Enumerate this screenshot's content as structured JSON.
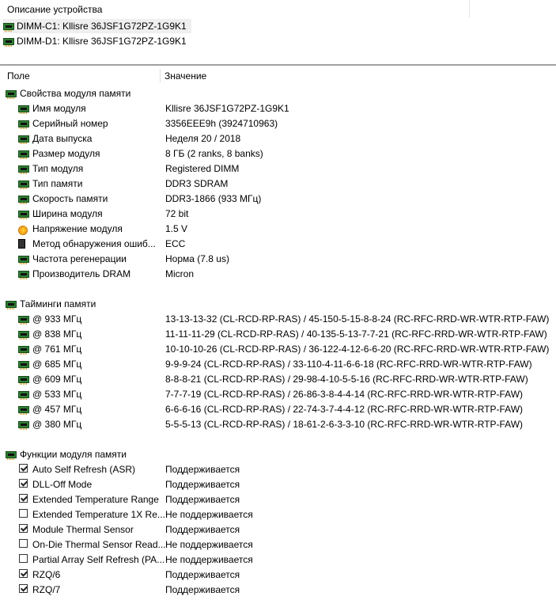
{
  "device_panel": {
    "title": "Описание устройства",
    "devices": [
      {
        "label": "DIMM-C1: Kllisre 36JSF1G72PZ-1G9K1",
        "selected": true
      },
      {
        "label": "DIMM-D1: Kllisre 36JSF1G72PZ-1G9K1",
        "selected": false
      }
    ]
  },
  "columns": {
    "field": "Поле",
    "value": "Значение"
  },
  "groups": {
    "props": {
      "label": "Свойства модуля памяти",
      "rows": [
        {
          "name": "Имя модуля",
          "value": "Kllisre 36JSF1G72PZ-1G9K1",
          "icon": "ram-icon"
        },
        {
          "name": "Серийный номер",
          "value": "3356EEE9h (3924710963)",
          "icon": "ram-icon"
        },
        {
          "name": "Дата выпуска",
          "value": "Неделя 20 / 2018",
          "icon": "ram-icon"
        },
        {
          "name": "Размер модуля",
          "value": "8 ГБ (2 ranks, 8 banks)",
          "icon": "ram-icon"
        },
        {
          "name": "Тип модуля",
          "value": "Registered DIMM",
          "icon": "ram-icon"
        },
        {
          "name": "Тип памяти",
          "value": "DDR3 SDRAM",
          "icon": "ram-icon"
        },
        {
          "name": "Скорость памяти",
          "value": "DDR3-1866 (933 МГц)",
          "icon": "ram-icon"
        },
        {
          "name": "Ширина модуля",
          "value": "72 bit",
          "icon": "ram-icon"
        },
        {
          "name": "Напряжение модуля",
          "value": "1.5 V",
          "icon": "voltage-icon"
        },
        {
          "name": "Метод обнаружения ошиб...",
          "value": "ECC",
          "icon": "chip-icon"
        },
        {
          "name": "Частота регенерации",
          "value": "Норма (7.8 us)",
          "icon": "ram-icon"
        },
        {
          "name": "Производитель DRAM",
          "value": "Micron",
          "icon": "ram-icon"
        }
      ]
    },
    "timings": {
      "label": "Тайминги памяти",
      "rows": [
        {
          "name": "@ 933 МГц",
          "value": "13-13-13-32  (CL-RCD-RP-RAS) / 45-150-5-15-8-8-24  (RC-RFC-RRD-WR-WTR-RTP-FAW)"
        },
        {
          "name": "@ 838 МГц",
          "value": "11-11-11-29  (CL-RCD-RP-RAS) / 40-135-5-13-7-7-21  (RC-RFC-RRD-WR-WTR-RTP-FAW)"
        },
        {
          "name": "@ 761 МГц",
          "value": "10-10-10-26  (CL-RCD-RP-RAS) / 36-122-4-12-6-6-20  (RC-RFC-RRD-WR-WTR-RTP-FAW)"
        },
        {
          "name": "@ 685 МГц",
          "value": "9-9-9-24  (CL-RCD-RP-RAS) / 33-110-4-11-6-6-18  (RC-RFC-RRD-WR-WTR-RTP-FAW)"
        },
        {
          "name": "@ 609 МГц",
          "value": "8-8-8-21  (CL-RCD-RP-RAS) / 29-98-4-10-5-5-16  (RC-RFC-RRD-WR-WTR-RTP-FAW)"
        },
        {
          "name": "@ 533 МГц",
          "value": "7-7-7-19  (CL-RCD-RP-RAS) / 26-86-3-8-4-4-14  (RC-RFC-RRD-WR-WTR-RTP-FAW)"
        },
        {
          "name": "@ 457 МГц",
          "value": "6-6-6-16  (CL-RCD-RP-RAS) / 22-74-3-7-4-4-12  (RC-RFC-RRD-WR-WTR-RTP-FAW)"
        },
        {
          "name": "@ 380 МГц",
          "value": "5-5-5-13  (CL-RCD-RP-RAS) / 18-61-2-6-3-3-10  (RC-RFC-RRD-WR-WTR-RTP-FAW)"
        }
      ]
    },
    "features": {
      "label": "Функции модуля памяти",
      "rows": [
        {
          "name": "Auto Self Refresh (ASR)",
          "value": "Поддерживается",
          "checked": true
        },
        {
          "name": "DLL-Off Mode",
          "value": "Поддерживается",
          "checked": true
        },
        {
          "name": "Extended Temperature Range",
          "value": "Поддерживается",
          "checked": true
        },
        {
          "name": "Extended Temperature 1X Re...",
          "value": "Не поддерживается",
          "checked": false
        },
        {
          "name": "Module Thermal Sensor",
          "value": "Поддерживается",
          "checked": true
        },
        {
          "name": "On-Die Thermal Sensor Read...",
          "value": "Не поддерживается",
          "checked": false
        },
        {
          "name": "Partial Array Self Refresh (PA...",
          "value": "Не поддерживается",
          "checked": false
        },
        {
          "name": "RZQ/6",
          "value": "Поддерживается",
          "checked": true
        },
        {
          "name": "RZQ/7",
          "value": "Поддерживается",
          "checked": true
        }
      ]
    }
  }
}
